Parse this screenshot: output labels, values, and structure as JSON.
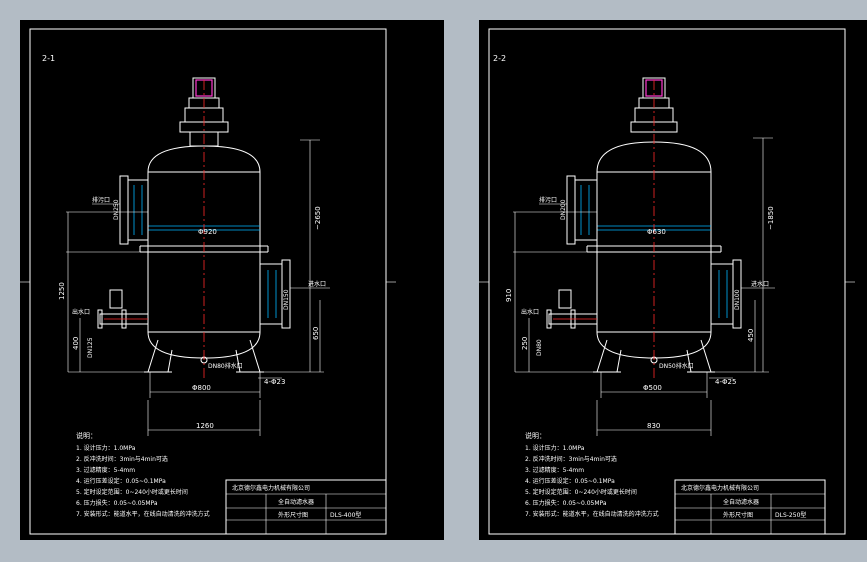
{
  "sheets": [
    {
      "id": "left",
      "sheet_no": "2-1",
      "dims": {
        "diameter": "Φ920",
        "height": "~2650",
        "d1": "1250",
        "d2": "400",
        "d3": "650",
        "base_dia": "Φ800",
        "base_width": "1260",
        "small": "4-Φ23"
      },
      "labels": {
        "top_port": "排污口",
        "right_port": "进水口",
        "left_port": "出水口",
        "bottom_port": "DN80排水口",
        "top_flange": "DN250",
        "right_flange": "DN150",
        "left_flange": "DN125"
      },
      "notes_title": "说明：",
      "notes": [
        "1. 设计压力：1.0MPa",
        "2. 反冲洗时间：3min与4min可选",
        "3. 过滤精度：5-4mm",
        "4. 运行压差设定：0.05~0.1MPa",
        "5. 定时设定范围：0~240小时或更长时间",
        "6. 压力损失：0.05~0.05MPa",
        "7. 安装形式：能道水平，在线自动清洗的冲洗方式"
      ],
      "title_block": {
        "company": "北京德尔鑫电力机械有限公司",
        "product": "全自动滤水器",
        "drawing": "外形尺寸图",
        "model": "DLS-400型"
      }
    },
    {
      "id": "right",
      "sheet_no": "2-2",
      "dims": {
        "diameter": "Φ630",
        "height": "~1850",
        "d1": "910",
        "d2": "250",
        "d3": "450",
        "base_dia": "Φ500",
        "base_width": "830",
        "small": "4-Φ25"
      },
      "labels": {
        "top_port": "排污口",
        "right_port": "进水口",
        "left_port": "出水口",
        "bottom_port": "DN50排水口",
        "top_flange": "DN200",
        "right_flange": "DN100",
        "left_flange": "DN80"
      },
      "notes_title": "说明：",
      "notes": [
        "1. 设计压力：1.0MPa",
        "2. 反冲洗时间：3min与4min可选",
        "3. 过滤精度：5-4mm",
        "4. 运行压差设定：0.05~0.1MPa",
        "5. 定时设定范围：0~240小时或更长时间",
        "6. 压力损失：0.05~0.05MPa",
        "7. 安装形式：能道水平，在线自动清洗的冲洗方式"
      ],
      "title_block": {
        "company": "北京德尔鑫电力机械有限公司",
        "product": "全自动滤水器",
        "drawing": "外形尺寸图",
        "model": "DLS-250型"
      }
    }
  ],
  "colors": {
    "background": "#b3bcc5",
    "sheet": "#000000",
    "outline": "#ffffff",
    "hidden": "#00b7ff",
    "centerline": "#ff2a2a",
    "motor": "#ff3bd0"
  }
}
